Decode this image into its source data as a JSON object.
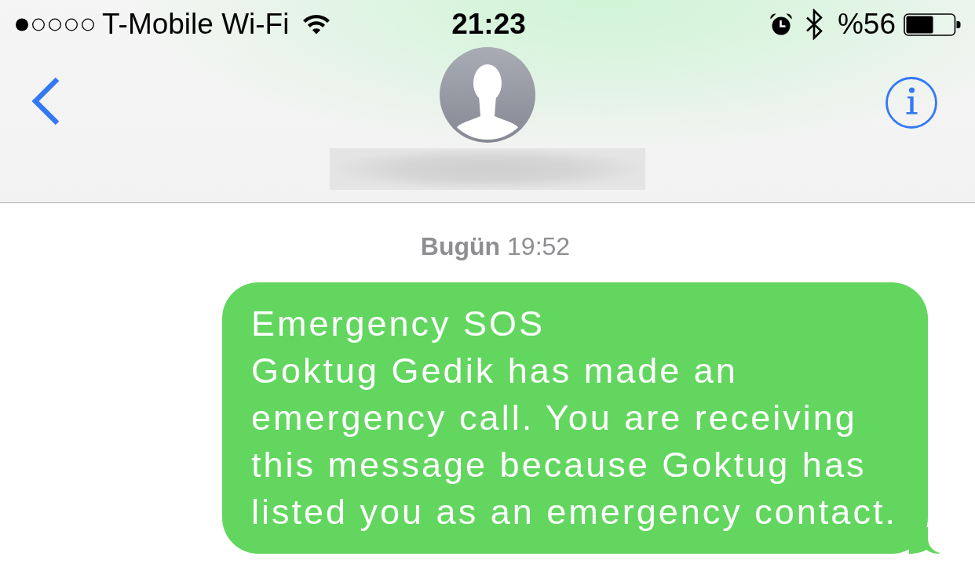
{
  "status_bar": {
    "carrier": "T-Mobile Wi-Fi",
    "time": "21:23",
    "battery_text": "%56"
  },
  "conversation": {
    "timestamp": "**Bugün** 19:52",
    "messages": [
      {
        "title": "Emergency SOS",
        "body": "Goktug Gedik has made an emergency call. You are receiving this message because Goktug has listed you as an emergency contact."
      }
    ]
  }
}
